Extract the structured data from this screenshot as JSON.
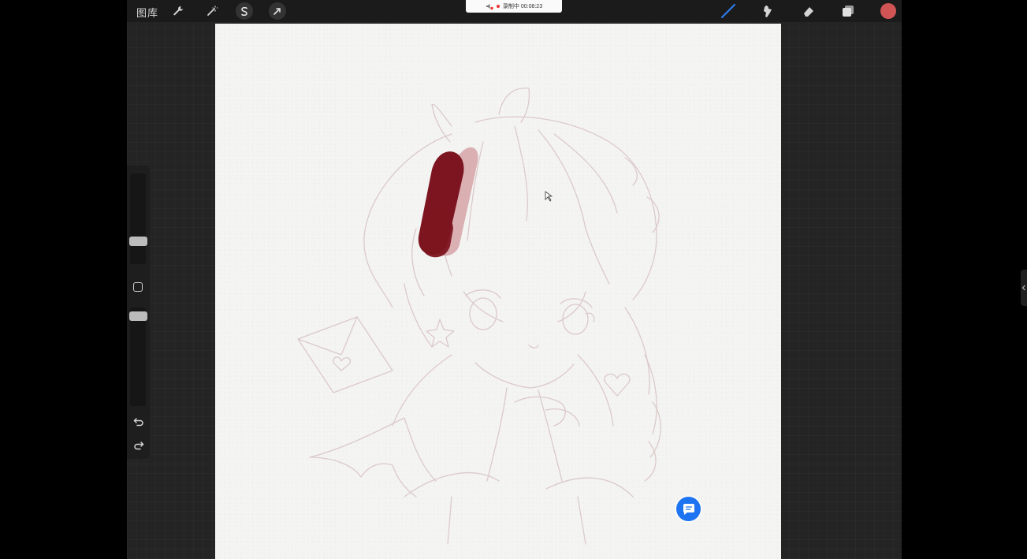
{
  "topbar": {
    "gallery_label": "图库",
    "recording_text": "录制中 00:08:23"
  },
  "tools": {
    "adjust_icon": "wrench-icon",
    "adjustments_icon": "magic-wand-icon",
    "selection_icon": "selection-s-icon",
    "transform_icon": "arrow-cursor-icon",
    "brush_icon": "brush-icon",
    "smudge_icon": "smudge-icon",
    "eraser_icon": "eraser-icon",
    "layers_icon": "layers-icon"
  },
  "colors": {
    "current_color": "#d15555",
    "stroke_dark": "#7d1520",
    "stroke_light": "#c77880",
    "sketch_line": "#d9c6c6",
    "chat_button": "#1e74f0"
  },
  "sidebar": {
    "brush_size_level": 0.6,
    "opacity_level": 0.0,
    "undo_icon": "undo-icon",
    "redo_icon": "redo-icon"
  },
  "floating": {
    "chat_icon": "chat-bubble-icon",
    "edge_tab_icon": "chevron-left-icon"
  }
}
